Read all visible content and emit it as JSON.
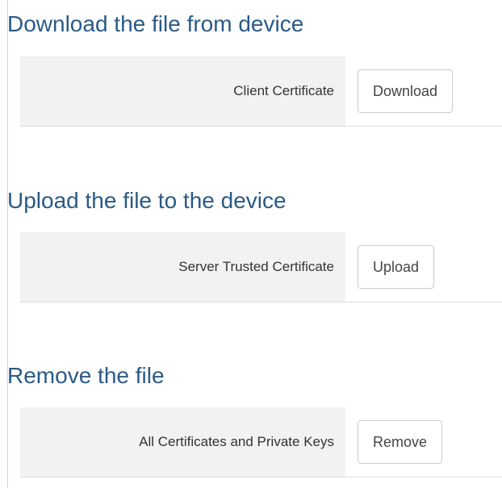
{
  "sections": [
    {
      "title": "Download the file from device",
      "label": "Client Certificate",
      "button": "Download"
    },
    {
      "title": "Upload the file to the device",
      "label": "Server Trusted Certificate",
      "button": "Upload"
    },
    {
      "title": "Remove the file",
      "label": "All Certificates and Private Keys",
      "button": "Remove"
    }
  ]
}
